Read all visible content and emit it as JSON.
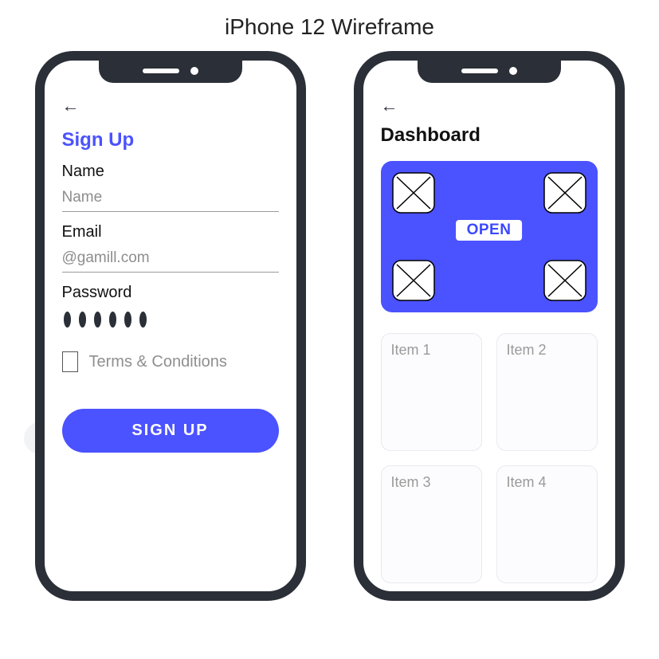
{
  "page_title": "iPhone 12 Wireframe",
  "accent_color": "#4b52ff",
  "phone1": {
    "back_glyph": "←",
    "title": "Sign Up",
    "fields": {
      "name": {
        "label": "Name",
        "placeholder": "Name"
      },
      "email": {
        "label": "Email",
        "placeholder": "@gamill.com"
      },
      "password": {
        "label": "Password",
        "dot_count": 6
      }
    },
    "terms_label": "Terms & Conditions",
    "cta_label": "SIGN  UP"
  },
  "phone2": {
    "back_glyph": "←",
    "title": "Dashboard",
    "hero": {
      "badge_label": "OPEN",
      "placeholder_count": 4
    },
    "cards": [
      "Item 1",
      "Item 2",
      "Item 3",
      "Item 4"
    ]
  }
}
